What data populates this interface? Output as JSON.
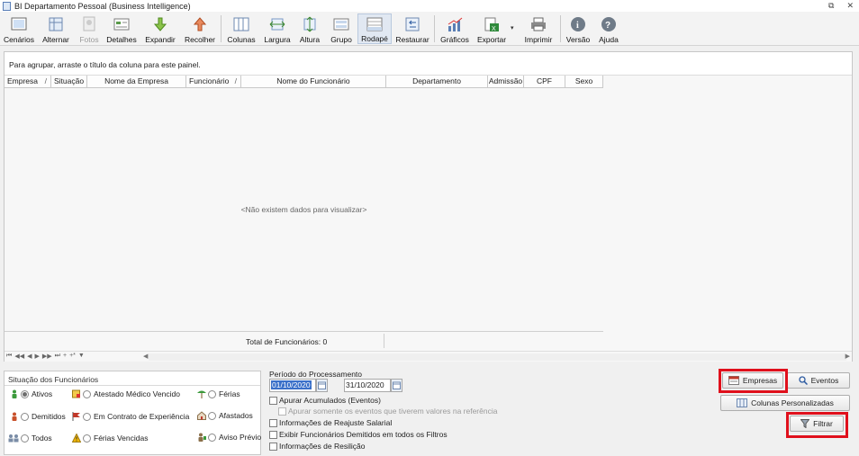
{
  "window": {
    "title": "BI Departamento Pessoal  (Business Intelligence)",
    "restore_glyph": "⧉",
    "close_glyph": "✕"
  },
  "toolbar": {
    "items": [
      {
        "label": "Cenários",
        "icon": "scenarios-icon"
      },
      {
        "label": "Alternar",
        "icon": "toggle-icon"
      },
      {
        "label": "Fotos",
        "icon": "photos-icon",
        "disabled": true
      },
      {
        "label": "Detalhes",
        "icon": "details-icon"
      },
      {
        "label": "Expandir",
        "icon": "expand-icon"
      },
      {
        "label": "Recolher",
        "icon": "collapse-icon"
      },
      {
        "label": "Colunas",
        "icon": "columns-icon"
      },
      {
        "label": "Largura",
        "icon": "width-icon"
      },
      {
        "label": "Altura",
        "icon": "height-icon"
      },
      {
        "label": "Grupo",
        "icon": "group-icon"
      },
      {
        "label": "Rodapé",
        "icon": "footer-icon",
        "pressed": true
      },
      {
        "label": "Restaurar",
        "icon": "restore-icon"
      },
      {
        "label": "Gráficos",
        "icon": "charts-icon"
      },
      {
        "label": "Exportar",
        "icon": "export-icon"
      },
      {
        "label": "Imprimir",
        "icon": "print-icon"
      },
      {
        "label": "Versão",
        "icon": "version-icon"
      },
      {
        "label": "Ajuda",
        "icon": "help-icon"
      }
    ]
  },
  "grid": {
    "group_hint": "Para agrupar, arraste o título da coluna para este painel.",
    "columns": [
      {
        "label": "Empresa",
        "sort": "/"
      },
      {
        "label": "Situação",
        "sort": ""
      },
      {
        "label": "Nome da Empresa",
        "sort": ""
      },
      {
        "label": "Funcionário",
        "sort": "/"
      },
      {
        "label": "Nome do Funcionário",
        "sort": ""
      },
      {
        "label": "Departamento",
        "sort": ""
      },
      {
        "label": "Admissão",
        "sort": ""
      },
      {
        "label": "CPF",
        "sort": ""
      },
      {
        "label": "Sexo",
        "sort": ""
      }
    ],
    "empty_text": "<Não existem dados para visualizar>",
    "footer_total": "Total de Funcionários: 0",
    "nav_buttons": [
      "⏮",
      "◀◀",
      "◀",
      "▶",
      "▶▶",
      "⏭",
      "+",
      "+*",
      "▼"
    ]
  },
  "situacao": {
    "title": "Situação dos Funcionários",
    "options": [
      {
        "label": "Ativos",
        "checked": true,
        "icon": "person-green-icon"
      },
      {
        "label": "Atestado Médico Vencido",
        "checked": false,
        "icon": "medical-certificate-icon"
      },
      {
        "label": "Férias",
        "checked": false,
        "icon": "vacation-icon"
      },
      {
        "label": "Demitidos",
        "checked": false,
        "icon": "person-red-icon"
      },
      {
        "label": "Em Contrato de Experiência",
        "checked": false,
        "icon": "flag-icon"
      },
      {
        "label": "Afastados",
        "checked": false,
        "icon": "away-icon"
      },
      {
        "label": "Todos",
        "checked": false,
        "icon": "people-icon"
      },
      {
        "label": "Férias Vencidas",
        "checked": false,
        "icon": "warning-icon"
      },
      {
        "label": "Aviso Prévio",
        "checked": false,
        "icon": "notice-icon"
      }
    ]
  },
  "periodo": {
    "label": "Período do Processamento",
    "start": "01/10/2020",
    "end": "31/10/2020",
    "checks": [
      {
        "label": "Apurar Acumulados (Eventos)",
        "disabled": false
      },
      {
        "label": "Apurar somente os eventos que tiverem valores na referência",
        "disabled": true
      },
      {
        "label": "Informações de Reajuste Salarial",
        "disabled": false
      },
      {
        "label": "Exibir Funcionários Demitidos em todos os Filtros",
        "disabled": false
      },
      {
        "label": "Informações de Resilição",
        "disabled": false
      }
    ]
  },
  "buttons": {
    "empresas": "Empresas",
    "eventos": "Eventos",
    "colunas": "Colunas Personalizadas",
    "filtrar": "Filtrar"
  },
  "colors": {
    "highlight": "#e0101c",
    "selection": "#3a70c9"
  }
}
